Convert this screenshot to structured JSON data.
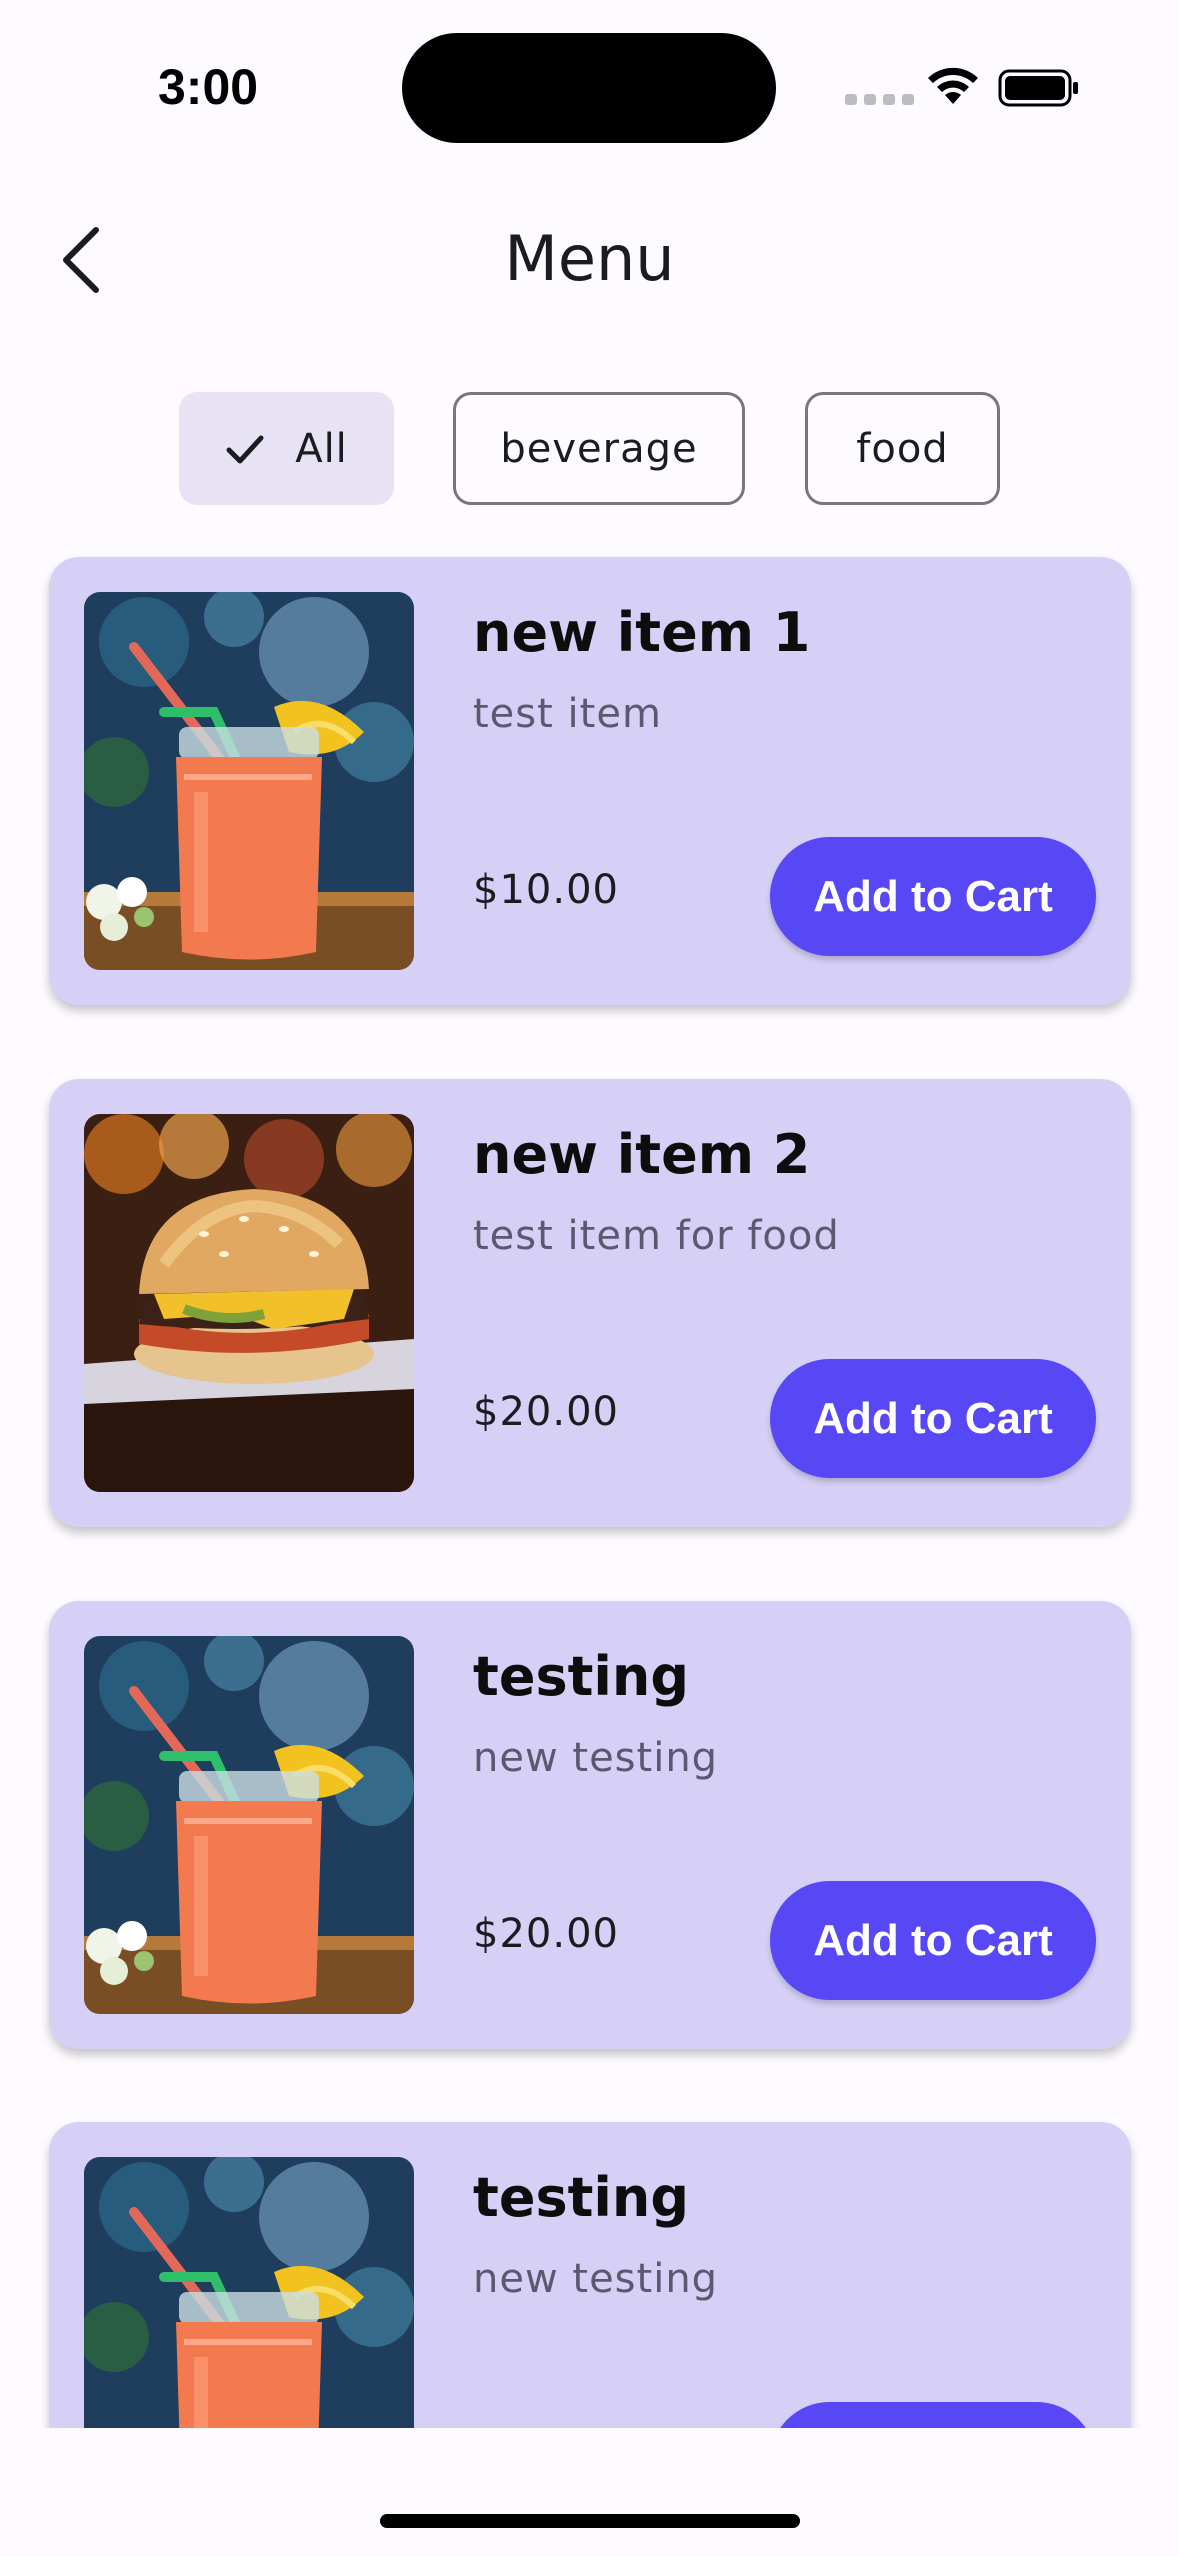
{
  "status_bar": {
    "time": "3:00"
  },
  "header": {
    "title": "Menu"
  },
  "filters": [
    {
      "label": "All",
      "selected": true
    },
    {
      "label": "beverage",
      "selected": false
    },
    {
      "label": "food",
      "selected": false
    }
  ],
  "items": [
    {
      "name": "new item 1",
      "description": "test item",
      "price": "$10.00",
      "button": "Add to Cart",
      "image": "drink-icon"
    },
    {
      "name": "new item 2",
      "description": "test item for food",
      "price": "$20.00",
      "button": "Add to Cart",
      "image": "burger-icon"
    },
    {
      "name": "testing",
      "description": "new testing",
      "price": "$20.00",
      "button": "Add to Cart",
      "image": "drink-icon"
    },
    {
      "name": "testing",
      "description": "new testing",
      "price": "",
      "button": "",
      "image": "drink-icon"
    }
  ],
  "colors": {
    "accent": "#5747f5",
    "card": "#d6d0f7",
    "chip_selected": "#e8e2f5"
  }
}
